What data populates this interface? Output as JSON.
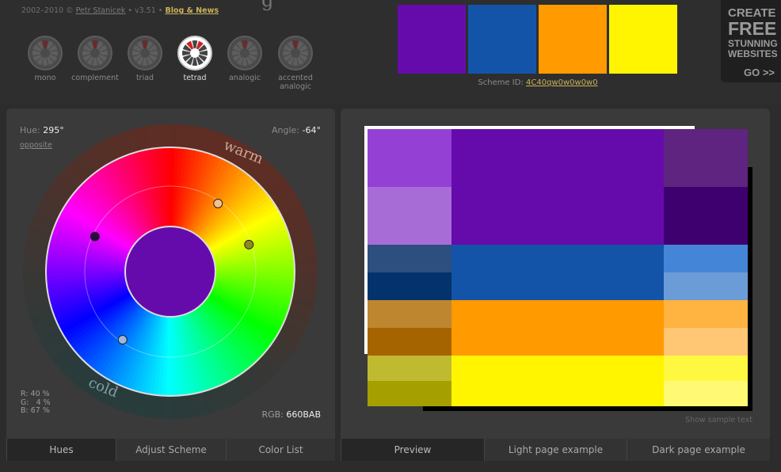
{
  "header": {
    "credits_prefix": "2002–2010 ©",
    "author": "Petr Stanicek",
    "version": "• v3.51 •",
    "blog_link": "Blog & News",
    "logo_fragment": "g"
  },
  "scheme_modes": [
    {
      "label": "mono",
      "icon": "mono-icon",
      "active": false
    },
    {
      "label": "complement",
      "icon": "complement-icon",
      "active": false
    },
    {
      "label": "triad",
      "icon": "triad-icon",
      "active": false
    },
    {
      "label": "tetrad",
      "icon": "tetrad-icon",
      "active": true
    },
    {
      "label": "analogic",
      "icon": "analogic-icon",
      "active": false
    },
    {
      "label": "accented analogic",
      "icon": "accented-analogic-icon",
      "active": false
    }
  ],
  "scheme": {
    "swatches": [
      "#660BAB",
      "#1354A8",
      "#FF9A00",
      "#FFF500"
    ],
    "id_label": "Scheme ID:",
    "id_value": "4C40qw0w0w0w0"
  },
  "ad": {
    "l1": "CREATE",
    "l2": "FREE",
    "l3": "STUNNING",
    "l4": "WEBSITES",
    "l5": "GO >>"
  },
  "wheel": {
    "hue_label": "Hue:",
    "hue_value": "295°",
    "opposite_link": "opposite",
    "angle_label": "Angle:",
    "angle_value": "-64°",
    "rgb_percent": "R: 40 %\nG:   4 %\nB: 67 %",
    "rgb_label": "RGB:",
    "rgb_value": "660BAB",
    "warm_label": "warm",
    "cold_label": "cold",
    "center_color": "#660BAB",
    "handles": [
      {
        "name": "primary-hue-handle",
        "color": "#2a0a45",
        "hue": 295
      },
      {
        "name": "secondary-hue-handle-1",
        "color": "#f4c28a",
        "hue": 35
      },
      {
        "name": "secondary-hue-handle-2",
        "color": "#8c8a25",
        "hue": 71
      },
      {
        "name": "secondary-hue-handle-3",
        "color": "#9eb6e0",
        "hue": 215
      }
    ]
  },
  "left_tabs": [
    {
      "label": "Hues",
      "active": true
    },
    {
      "label": "Adjust Scheme",
      "active": false
    },
    {
      "label": "Color List",
      "active": false
    }
  ],
  "right_tabs": [
    {
      "label": "Preview",
      "active": true
    },
    {
      "label": "Light page example",
      "active": false
    },
    {
      "label": "Dark page example",
      "active": false
    }
  ],
  "preview": {
    "show_sample": "Show sample text",
    "rows": [
      {
        "left": [
          "#9440D5",
          "#A86CD7"
        ],
        "main": "#660BAB",
        "right": [
          "#5F2380",
          "#3F006F"
        ]
      },
      {
        "left": [
          "#2C4F80",
          "#03326D"
        ],
        "main": "#1354A8",
        "right": [
          "#4485D8",
          "#6B9CD8"
        ]
      },
      {
        "left": [
          "#BF8630",
          "#A66400"
        ],
        "main": "#FF9A00",
        "right": [
          "#FFB340",
          "#FFC673"
        ]
      },
      {
        "left": [
          "#BFBA30",
          "#A69F00"
        ],
        "main": "#FFF500",
        "right": [
          "#FFF840",
          "#FFF973"
        ]
      }
    ]
  }
}
